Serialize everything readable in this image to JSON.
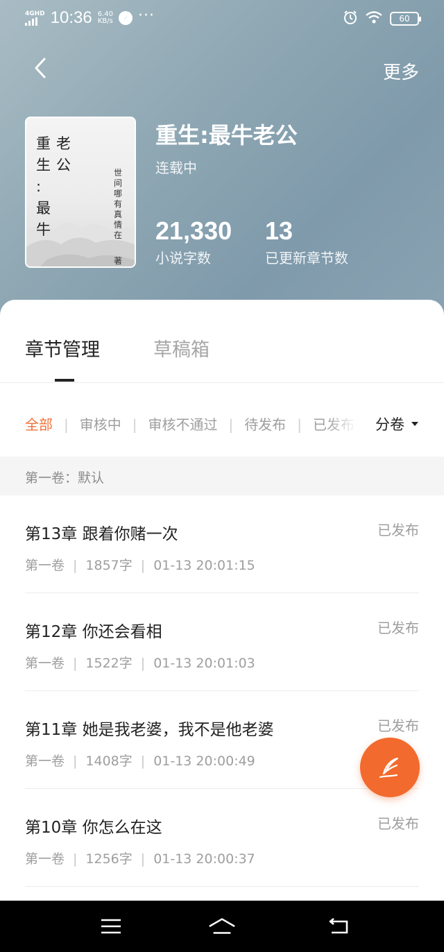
{
  "status_bar": {
    "network": "4GHD",
    "time": "10:36",
    "speed_value": "6.40",
    "speed_unit": "KB/s",
    "overflow": "···",
    "battery": "60"
  },
  "header": {
    "more_label": "更多"
  },
  "book": {
    "cover_title_col1": [
      "重",
      "生",
      ":",
      "最",
      "牛"
    ],
    "cover_title_col2": [
      "老",
      "公"
    ],
    "cover_author_chars": [
      "世",
      "间",
      "哪",
      "有",
      "真",
      "情",
      "在"
    ],
    "cover_author_suffix": "著",
    "title": "重生:最牛老公",
    "status": "连载中",
    "word_count": "21,330",
    "word_count_label": "小说字数",
    "chapter_count": "13",
    "chapter_count_label": "已更新章节数"
  },
  "tabs": [
    {
      "label": "章节管理",
      "active": true
    },
    {
      "label": "草稿箱",
      "active": false
    }
  ],
  "filters": {
    "items": [
      "全部",
      "审核中",
      "审核不通过",
      "待发布",
      "已发布"
    ],
    "active_index": 0,
    "volume_button": "分卷"
  },
  "volume_header": "第一卷：默认",
  "chapters": [
    {
      "title": "第13章 跟着你赌一次",
      "volume": "第一卷",
      "words": "1857字",
      "time": "01-13 20:01:15",
      "status": "已发布"
    },
    {
      "title": "第12章 你还会看相",
      "volume": "第一卷",
      "words": "1522字",
      "time": "01-13 20:01:03",
      "status": "已发布"
    },
    {
      "title": "第11章 她是我老婆，我不是他老婆",
      "volume": "第一卷",
      "words": "1408字",
      "time": "01-13 20:00:49",
      "status": "已发布"
    },
    {
      "title": "第10章 你怎么在这",
      "volume": "第一卷",
      "words": "1256字",
      "time": "01-13 20:00:37",
      "status": "已发布"
    }
  ],
  "colors": {
    "accent": "#f0733a",
    "fab": "#f26a2d",
    "header_gradient_start": "#a9bcc4",
    "header_gradient_end": "#7f9aab"
  },
  "icons": {
    "back": "chevron-left-icon",
    "fab": "quill-pen-icon",
    "nav_menu": "menu-icon",
    "nav_home": "home-icon",
    "nav_back": "return-icon"
  }
}
